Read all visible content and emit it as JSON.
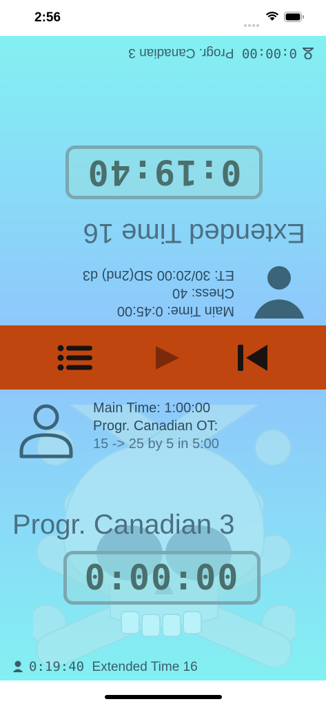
{
  "status_bar": {
    "time": "2:56"
  },
  "top_player": {
    "footer_time": "0:00:00",
    "footer_label": "Progr. Canadian 3",
    "clock": "0:19:40",
    "name": "Extended Time 16",
    "info": [
      "Main Time: 0:45:00",
      "Chess: 40",
      "ET: 30/20:00 SD(2nd) d3"
    ]
  },
  "controls": {
    "list_icon": "list-icon",
    "play_icon": "play-icon",
    "reset_icon": "skip-back-icon",
    "background": "#c0460f"
  },
  "bottom_player": {
    "info": [
      "Main Time: 1:00:00",
      "Progr. Canadian OT:",
      "15 -> 25 by 5 in 5:00"
    ],
    "name": "Progr. Canadian 3",
    "clock": "0:00:00",
    "footer_time": "0:19:40",
    "footer_label": "Extended Time 16",
    "background_icon": "skull-crossbones-icon"
  }
}
